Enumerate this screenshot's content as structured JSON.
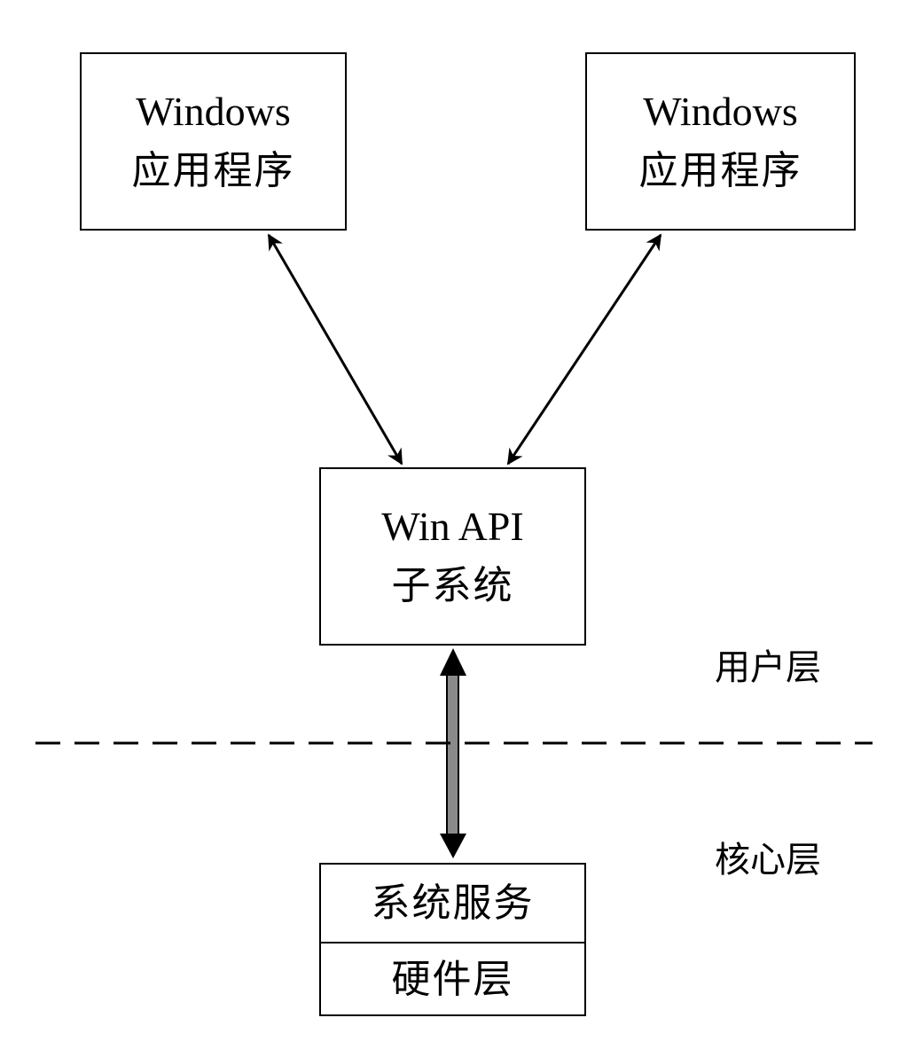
{
  "nodes": {
    "app_left": {
      "line1": "Windows",
      "line2": "应用程序"
    },
    "app_right": {
      "line1": "Windows",
      "line2": "应用程序"
    },
    "winapi": {
      "line1": "Win API",
      "line2": "子系统"
    },
    "kernel": {
      "top": "系统服务",
      "bottom": "硬件层"
    }
  },
  "layers": {
    "user": "用户层",
    "kernel": "核心层"
  },
  "edges": [
    {
      "from": "app_left",
      "to": "winapi",
      "type": "bidirectional"
    },
    {
      "from": "app_right",
      "to": "winapi",
      "type": "bidirectional"
    },
    {
      "from": "winapi",
      "to": "kernel",
      "type": "bidirectional"
    }
  ],
  "colors": {
    "line": "#000000",
    "background": "#ffffff",
    "vertical_arrow_fill": "#8a8a8a"
  }
}
